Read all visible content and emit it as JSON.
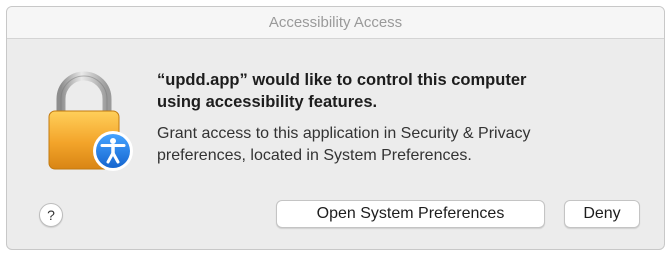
{
  "dialog": {
    "title": "Accessibility Access",
    "headline_line1": "“updd.app” would like to control this computer",
    "headline_line2": "using accessibility features.",
    "body_line1": "Grant access to this application in Security & Privacy",
    "body_line2": "preferences, located in System Preferences.",
    "help_label": "?",
    "buttons": {
      "open_prefs": "Open System Preferences",
      "deny": "Deny"
    },
    "icons": {
      "lock": "lock-icon",
      "accessibility": "accessibility-icon"
    },
    "colors": {
      "window_bg": "#ececec",
      "lock_gold": "#f0a52a",
      "accessibility_blue": "#1e7be0"
    }
  }
}
